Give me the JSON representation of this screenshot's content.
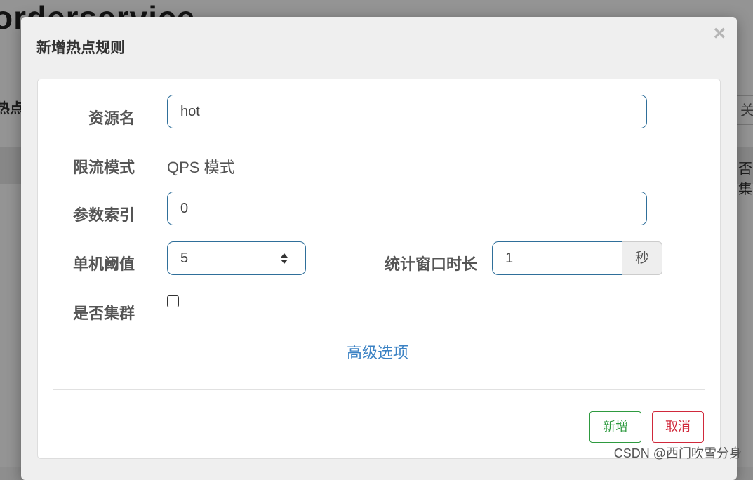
{
  "background": {
    "page_title": "orderservice",
    "left_text": "热点参",
    "right_button": "关",
    "right_text": "否集"
  },
  "modal": {
    "title": "新增热点规则",
    "close_glyph": "×",
    "fields": {
      "resource_label": "资源名",
      "resource_value": "hot",
      "mode_label": "限流模式",
      "mode_value": "QPS 模式",
      "param_index_label": "参数索引",
      "param_index_value": "0",
      "threshold_label": "单机阈值",
      "threshold_value": "5",
      "window_label": "统计窗口时长",
      "window_value": "1",
      "window_unit": "秒",
      "cluster_label": "是否集群",
      "cluster_checked": false
    },
    "advanced_link": "高级选项",
    "buttons": {
      "add": "新增",
      "cancel": "取消"
    }
  },
  "watermark": "CSDN @西门吹雪分身",
  "colors": {
    "accent_blue": "#3b82c4",
    "input_border": "#2f6f9a",
    "success_green": "#2e9a3f",
    "danger_red": "#d0293b"
  }
}
